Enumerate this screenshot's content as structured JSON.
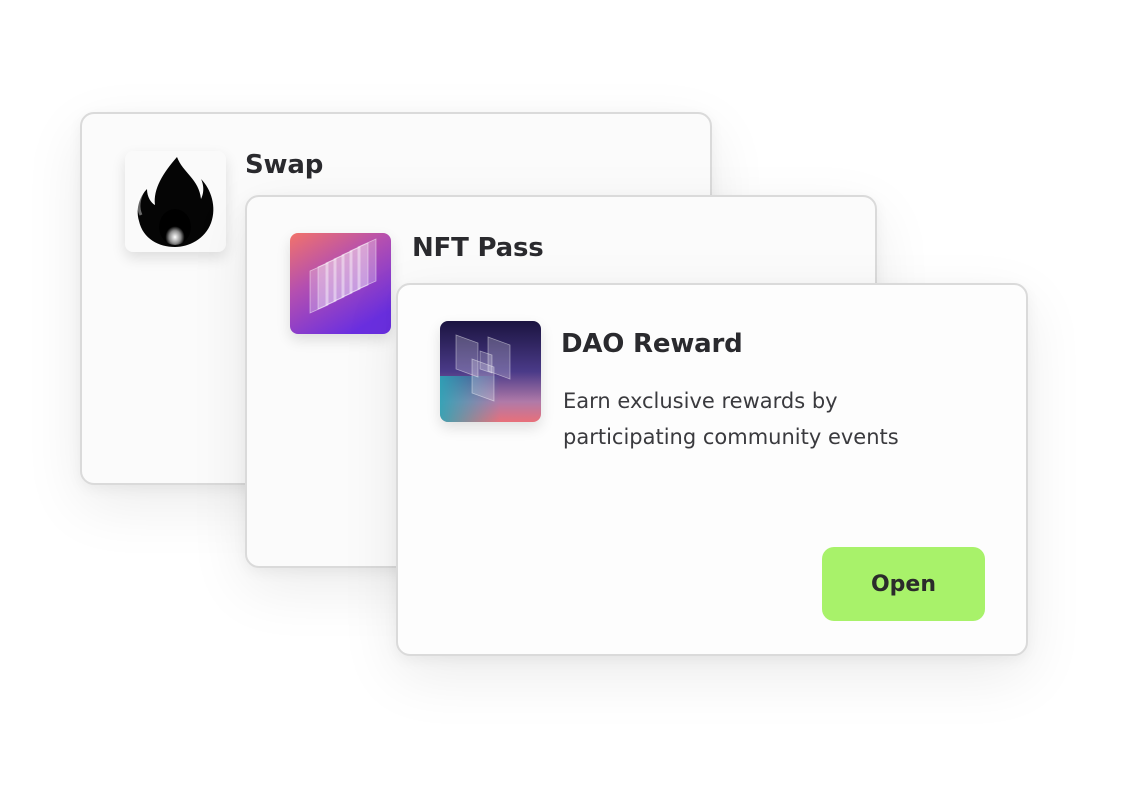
{
  "cards": [
    {
      "title": "Swap",
      "icon": "flame-icon"
    },
    {
      "title": "NFT Pass",
      "icon": "nft-layers-icon"
    },
    {
      "title": "DAO Reward",
      "icon": "dao-blocks-icon",
      "description_lines": [
        "Earn exclusive rewards by",
        "participating community events"
      ],
      "button_label": "Open"
    }
  ],
  "colors": {
    "button_bg": "#a8f26a",
    "card_border": "#dadada",
    "title_text": "#2a2a2e"
  }
}
